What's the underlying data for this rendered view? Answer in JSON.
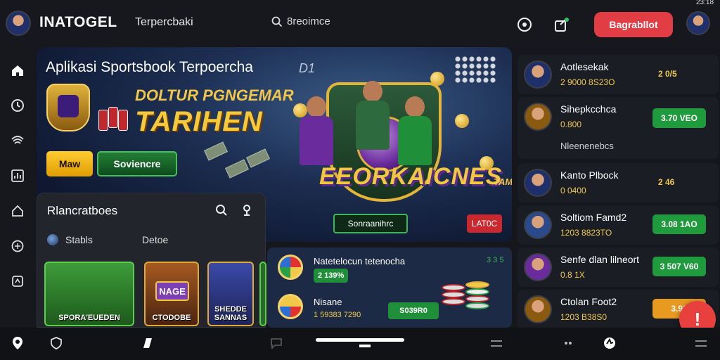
{
  "header": {
    "brand": "INATOGEL",
    "subtitle": "Terpercbaki",
    "search_text": "8reoimce",
    "cta_label": "Bagrabllot",
    "status_time": "23:18"
  },
  "hero": {
    "title": "Aplikasi Sportsbook Terpoercha",
    "tag": "D1",
    "promo_line1": "DOLTUR PGNGEMAR",
    "promo_line2": "TARIHEN",
    "btn_primary": "Maw",
    "btn_secondary": "Soviencre",
    "game_title": "EEORKAICNES",
    "game_tag": "TAMGEEL",
    "btn_outline": "Sonraanihrc",
    "btn_red": "LAT0C"
  },
  "popular": {
    "title": "Rlancratboes",
    "tabs": [
      "Stabls",
      "Detoe"
    ],
    "tiles": [
      "SPORA'EUEDEN",
      "CTODOBE",
      "SHEDDE SANNAS"
    ],
    "tile_badge": "NAGE"
  },
  "promo": {
    "row1_title": "Natetelocun tetenocha",
    "row1_value": "2 139%",
    "row1_score": "3 3 5",
    "row2_title": "Nisane",
    "row2_value": "1 59383 7290",
    "row2_btn": "S039R0"
  },
  "right_list": [
    {
      "name": "Aotlesekak",
      "sub": "2 9000 8S23O",
      "btn": "2 0/5",
      "btn_color": "none"
    },
    {
      "name": "Sihepkcchca",
      "sub": "0.800",
      "extra": "Nleenenebcs",
      "btn": "3.70 VEO",
      "btn_color": "#1f9a3d"
    },
    {
      "name": "Kanto Plbock",
      "sub": "0 0400",
      "btn": "2 46",
      "btn_color": "none"
    },
    {
      "name": "Soltiom Famd2",
      "sub": "1203 8823TO",
      "btn": "3.08 1AO",
      "btn_color": "#1f9a3d"
    },
    {
      "name": "Senfe dlan lilneort",
      "sub": "0.8 1X",
      "btn": "3 507 V60",
      "btn_color": "#1f9a3d"
    },
    {
      "name": "Ctolan Foot2",
      "sub": "1203 B38S0",
      "btn": "3.91",
      "btn_color": "#e89a20"
    }
  ],
  "bottom_nav": [
    "location-icon",
    "shield-icon",
    "bet-icon",
    "chat-icon",
    "menu-icon",
    "menu-icon",
    "profile-icon",
    "sport-icon",
    "menu-icon"
  ]
}
